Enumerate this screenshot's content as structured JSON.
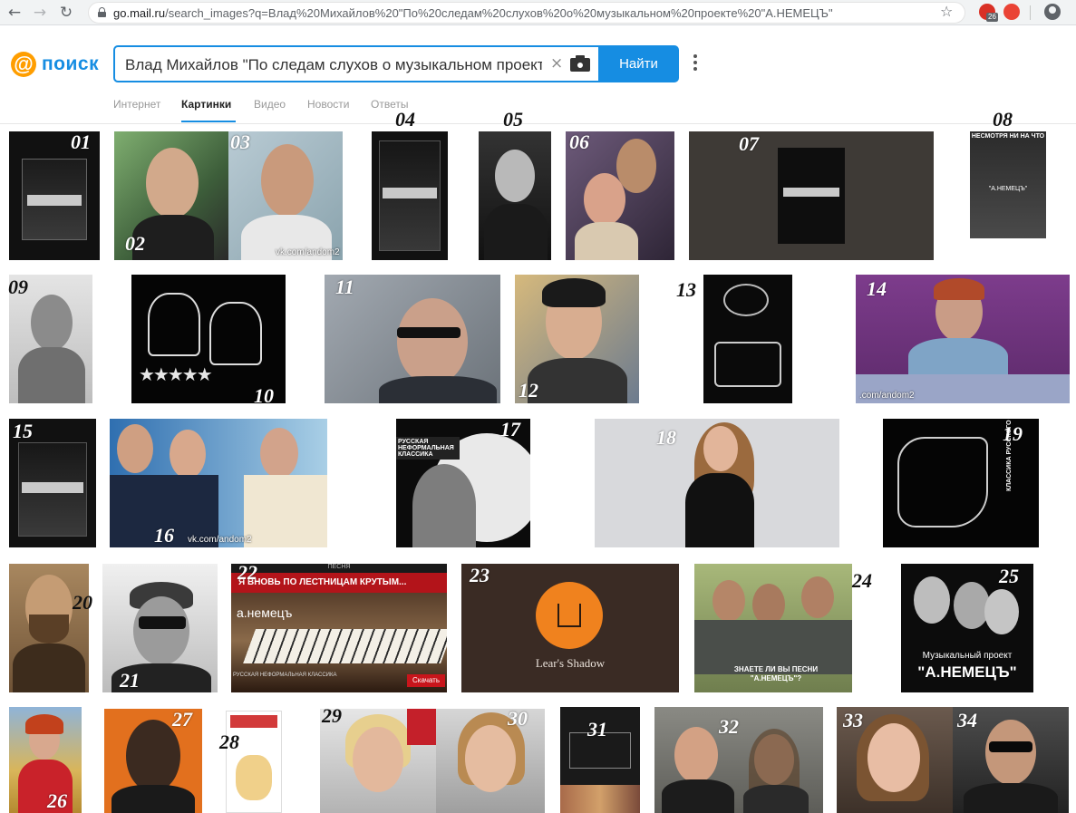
{
  "browser": {
    "url_host": "go.mail.ru",
    "url_rest": "/search_images?q=Влад%20Михайлов%20\"По%20следам%20слухов%20о%20музыкальном%20проекте%20\"А.НЕМЕЦЪ\"",
    "ext_badge": "26"
  },
  "logo": {
    "symbol": "@",
    "text": "поиск"
  },
  "search": {
    "query": "Влад Михайлов \"По следам слухов о музыкальном проекте \"А.НЕМЕЦЪ\"",
    "button": "Найти"
  },
  "tabs": [
    {
      "label": "Интернет",
      "active": false
    },
    {
      "label": "Картинки",
      "active": true
    },
    {
      "label": "Видео",
      "active": false
    },
    {
      "label": "Новости",
      "active": false
    },
    {
      "label": "Ответы",
      "active": false
    }
  ],
  "results": [
    {
      "n": "01",
      "desc": "А.НЕМЕЦЪ Samizdat cover"
    },
    {
      "n": "02",
      "desc": "man with goatee",
      "watermark": ""
    },
    {
      "n": "03",
      "desc": "smiling man",
      "watermark": "vk.com/andom2"
    },
    {
      "n": "04",
      "desc": "А.НЕМЕЦЪ Samizdat cover"
    },
    {
      "n": "05",
      "desc": "singer in leather jacket"
    },
    {
      "n": "06",
      "desc": "couple photo"
    },
    {
      "n": "07",
      "desc": "А.НЕМЕЦЪ cover on dark"
    },
    {
      "n": "08",
      "desc": "hooded figure",
      "caption": "НЕСМОТРЯ НИ НА ЧТО",
      "sub": "\"А.НЕМЕЦЪ\""
    },
    {
      "n": "09",
      "desc": "vintage portrait"
    },
    {
      "n": "10",
      "desc": "spy drawing"
    },
    {
      "n": "11",
      "desc": "man in sunglasses saluting"
    },
    {
      "n": "12",
      "desc": "actor portrait"
    },
    {
      "n": "13",
      "desc": "typewriter drawing"
    },
    {
      "n": "14",
      "desc": "woman at table",
      "watermark": ".com/andom2"
    },
    {
      "n": "15",
      "desc": "А.НЕМЕЦЪ Samizdat cover"
    },
    {
      "n": "16",
      "desc": "TV hosts collage",
      "watermark": "vk.com/andom2"
    },
    {
      "n": "17",
      "desc": "wolf howling",
      "caption": "РУССКАЯ НЕФОРМАЛЬНАЯ КЛАССИКА"
    },
    {
      "n": "18",
      "desc": "woman in black dress"
    },
    {
      "n": "19",
      "desc": "line art",
      "caption": "КЛАССИКА РУССКОГО ШАНСОНА"
    },
    {
      "n": "20",
      "desc": "bearded man portrait"
    },
    {
      "n": "21",
      "desc": "man in cap and sunglasses"
    },
    {
      "n": "22",
      "desc": "piano keys",
      "caption": "Я ВНОВЬ ПО ЛЕСТНИЦАМ КРУТЫМ...",
      "sub": "а.немецъ",
      "top": "ПЕСНЯ",
      "bottom": "РУССКАЯ НЕФОРМАЛЬНАЯ КЛАССИКА",
      "action": "Скачать"
    },
    {
      "n": "23",
      "desc": "Lear's Shadow logo",
      "caption": "Lear's Shadow"
    },
    {
      "n": "24",
      "desc": "men meme",
      "caption": "ЗНАЕТЕ ЛИ ВЫ ПЕСНИ \"А.НЕМЕЦЪ\"?"
    },
    {
      "n": "25",
      "desc": "Музыкальный проект А.НЕМЕЦЪ",
      "caption": "Музыкальный проект",
      "sub": "\"А.НЕМЕЦЪ\""
    },
    {
      "n": "26",
      "desc": "woman in wheat field"
    },
    {
      "n": "27",
      "desc": "man on orange"
    },
    {
      "n": "28",
      "desc": "book cover"
    },
    {
      "n": "29",
      "desc": "blonde woman"
    },
    {
      "n": "30",
      "desc": "smiling woman"
    },
    {
      "n": "31",
      "desc": "book cover dark"
    },
    {
      "n": "32",
      "desc": "man and woman"
    },
    {
      "n": "33",
      "desc": "woman selfie"
    },
    {
      "n": "34",
      "desc": "man in sunglasses"
    }
  ],
  "colors": {
    "brand_blue": "#168de2",
    "brand_orange": "#ff9e00"
  }
}
